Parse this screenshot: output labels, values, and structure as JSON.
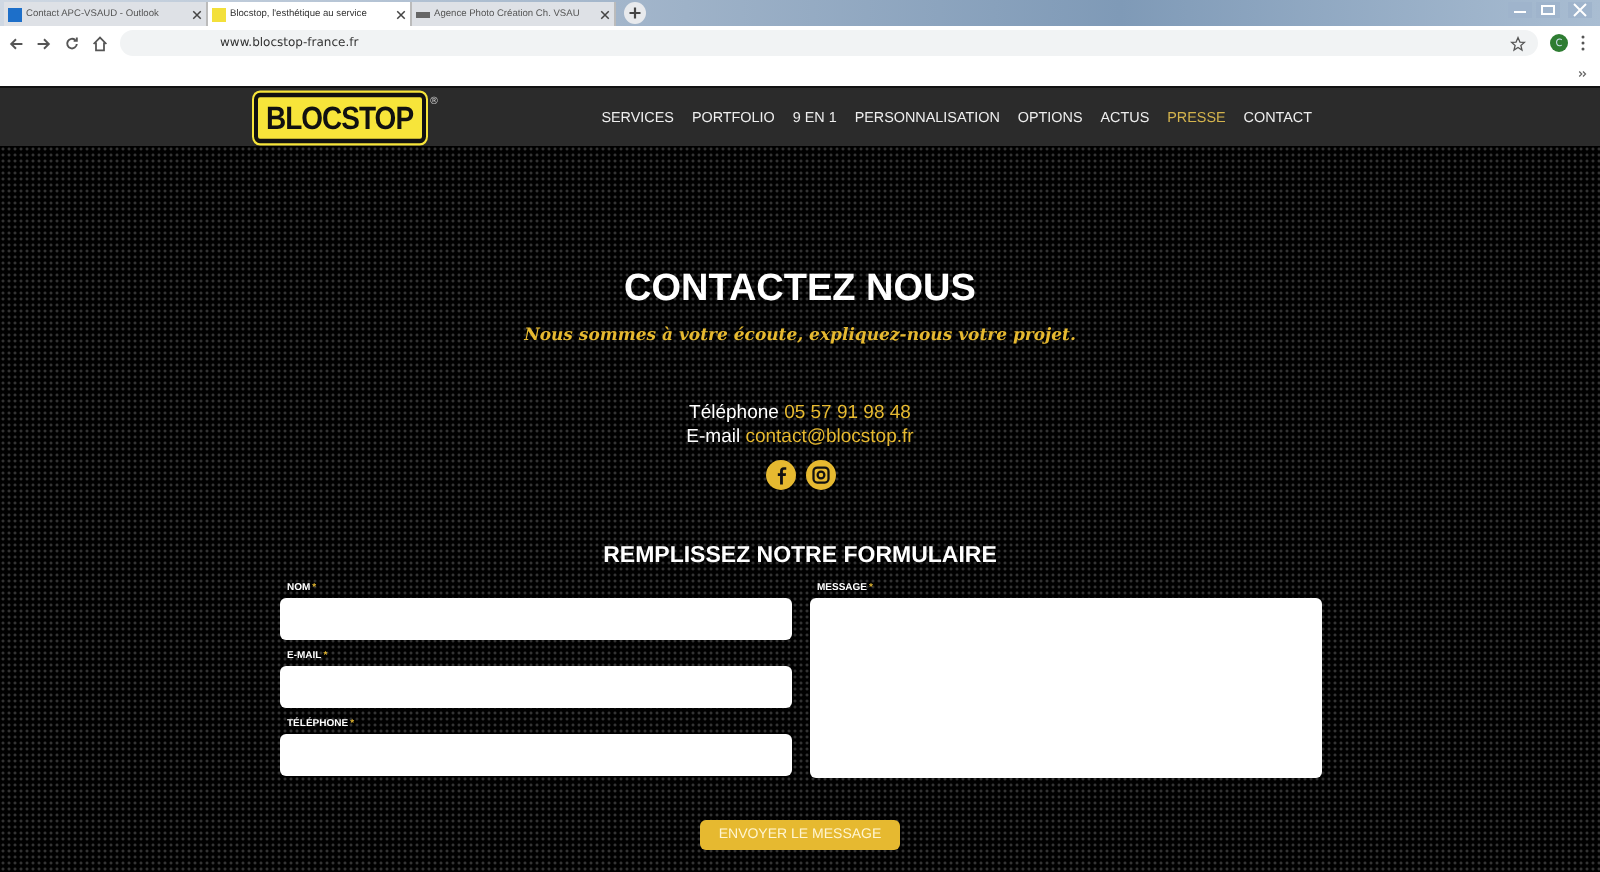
{
  "browser": {
    "tabs": [
      {
        "title": "Contact APC-VSAUD - Outlook",
        "selected": false,
        "kind": "mail"
      },
      {
        "title": "Blocstop, l'esthétique au service",
        "selected": true,
        "kind": "site"
      },
      {
        "title": "Agence Photo Création Ch. VSAU",
        "selected": false,
        "kind": "agency"
      }
    ],
    "url": "www.blocstop-france.fr",
    "profile_initial": "C"
  },
  "header": {
    "logo": "BLOCSTOP",
    "logo_mark": "®",
    "nav": [
      {
        "label": "SERVICES",
        "selected": false
      },
      {
        "label": "PORTFOLIO",
        "selected": false
      },
      {
        "label": "9 EN 1",
        "selected": false
      },
      {
        "label": "PERSONNALISATION",
        "selected": false
      },
      {
        "label": "OPTIONS",
        "selected": false
      },
      {
        "label": "ACTUS",
        "selected": false
      },
      {
        "label": "PRESSE",
        "selected": true
      },
      {
        "label": "CONTACT",
        "selected": false
      }
    ]
  },
  "contact": {
    "title": "CONTACTEZ NOUS",
    "subtitle": "Nous sommes à votre écoute, expliquez-nous votre projet.",
    "phone_label": "Téléphone",
    "phone": "05 57 91 98 48",
    "email_label": "E-mail",
    "email": "contact@blocstop.fr"
  },
  "form": {
    "title": "REMPLISSEZ NOTRE FORMULAIRE",
    "fields": [
      {
        "label": "NOM",
        "mark": "*"
      },
      {
        "label": "E-MAIL",
        "mark": "*"
      },
      {
        "label": "TÉLÉPHONE",
        "mark": "*"
      }
    ],
    "message": {
      "label": "MESSAGE",
      "mark": "*"
    },
    "submit": "ENVOYER LE MESSAGE"
  }
}
